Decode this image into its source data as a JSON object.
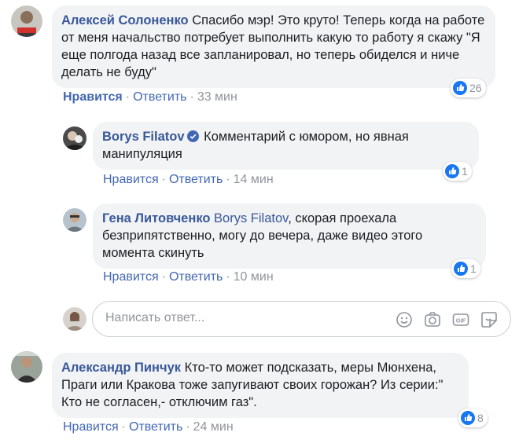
{
  "comments": [
    {
      "author": "Алексей Солоненко",
      "text": "Спасибо мэр! Это круто! Теперь когда на работе от меня начальство потребует выполнить какую то работу я скажу \"Я еще полгода назад все запланировал, но теперь обиделся и ниче делать не буду\"",
      "like_label": "Нравится",
      "reply_label": "Ответить",
      "time": "33 мин",
      "reactions": "26"
    },
    {
      "author": "Borys Filatov",
      "verified": true,
      "text": "Комментарий с юмором, но явная манипуляция",
      "like_label": "Нравится",
      "reply_label": "Ответить",
      "time": "14 мин",
      "reactions": "1"
    },
    {
      "author": "Гена Литовченко",
      "mention": "Borys Filatov",
      "text": ", скорая проехала безприпятственно, могу до вечера, даже видео этого момента скинуть",
      "like_label": "Нравится",
      "reply_label": "Ответить",
      "time": "10 мин",
      "reactions": "1"
    },
    {
      "author": "Александр Пинчук",
      "text": "Кто-то может подсказать, меры Мюнхена, Праги или Кракова тоже запугивают своих горожан? Из серии:\" Кто не согласен,- отключим газ\".",
      "like_label": "Нравится",
      "reply_label": "Ответить",
      "time": "24 мин",
      "reactions": "8"
    }
  ],
  "reply_input": {
    "placeholder": "Написать ответ..."
  },
  "separator": "·",
  "icons": [
    "verified-badge-icon",
    "like-reaction-icon",
    "emoji-icon",
    "camera-icon",
    "gif-icon",
    "sticker-icon"
  ],
  "colors": {
    "link": "#385898",
    "action": "#4267b2",
    "muted": "#90949c",
    "bubble": "#f2f3f5",
    "like": "#1877f2"
  }
}
